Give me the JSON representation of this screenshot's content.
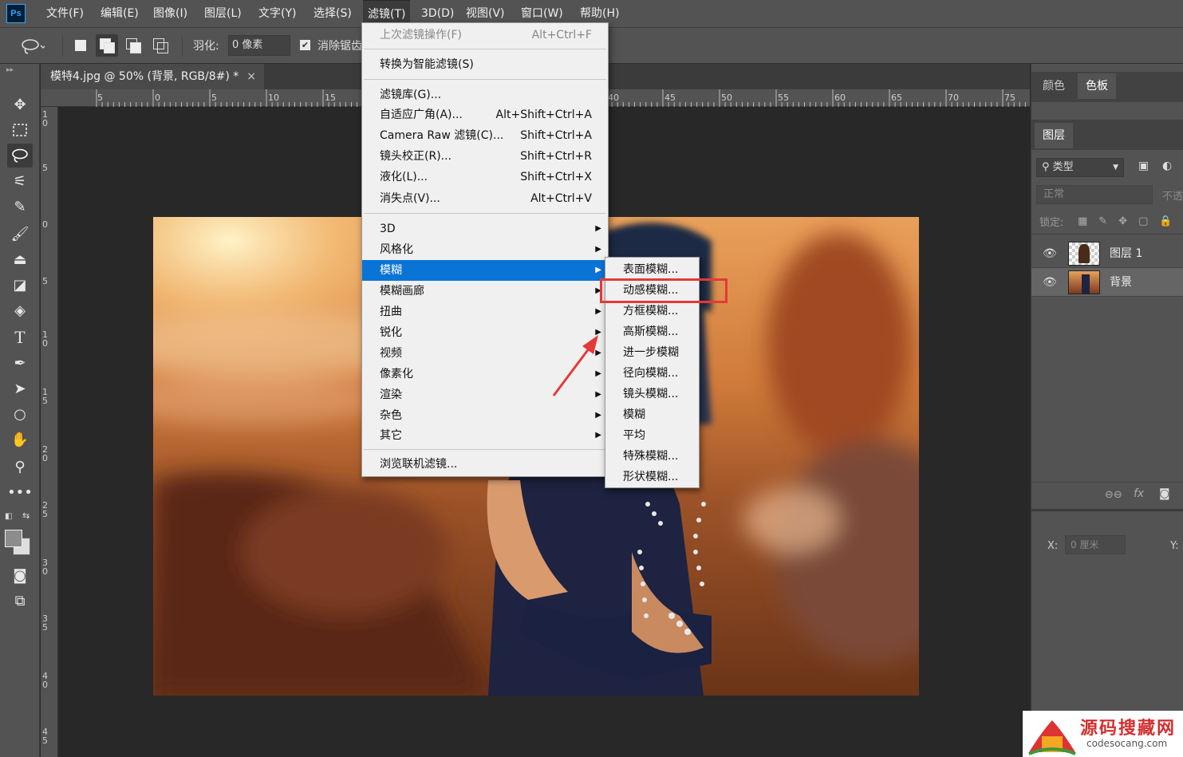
{
  "app": {
    "logo": "Ps"
  },
  "menubar": {
    "items": [
      "文件(F)",
      "编辑(E)",
      "图像(I)",
      "图层(L)",
      "文字(Y)",
      "选择(S)",
      "滤镜(T)",
      "3D(D)",
      "视图(V)",
      "窗口(W)",
      "帮助(H)"
    ]
  },
  "options": {
    "feather_label": "羽化:",
    "feather_value": "0 像素",
    "antialias_label": "消除锯齿"
  },
  "document": {
    "tab_title": "模特4.jpg @ 50% (背景, RGB/8#) *",
    "close_glyph": "×"
  },
  "rulers": {
    "h_ticks": [
      "5",
      "0",
      "5",
      "10",
      "15",
      "40",
      "45",
      "50",
      "55",
      "60",
      "65",
      "70",
      "75"
    ],
    "v_ticks": [
      "1 0",
      "5",
      "0",
      "5",
      "1 0",
      "1 5",
      "2 0",
      "2 5",
      "3 0",
      "3 5",
      "4 0",
      "4 5"
    ]
  },
  "filter_menu": {
    "last_filter": {
      "label": "上次滤镜操作(F)",
      "shortcut": "Alt+Ctrl+F"
    },
    "smart": "转换为智能滤镜(S)",
    "group1": [
      {
        "label": "滤镜库(G)...",
        "shortcut": ""
      },
      {
        "label": "自适应广角(A)...",
        "shortcut": "Alt+Shift+Ctrl+A"
      },
      {
        "label": "Camera Raw 滤镜(C)...",
        "shortcut": "Shift+Ctrl+A"
      },
      {
        "label": "镜头校正(R)...",
        "shortcut": "Shift+Ctrl+R"
      },
      {
        "label": "液化(L)...",
        "shortcut": "Shift+Ctrl+X"
      },
      {
        "label": "消失点(V)...",
        "shortcut": "Alt+Ctrl+V"
      }
    ],
    "submenus": [
      "3D",
      "风格化",
      "模糊",
      "模糊画廊",
      "扭曲",
      "锐化",
      "视频",
      "像素化",
      "渲染",
      "杂色",
      "其它"
    ],
    "browse": "浏览联机滤镜..."
  },
  "blur_submenu": [
    "表面模糊...",
    "动感模糊...",
    "方框模糊...",
    "高斯模糊...",
    "进一步模糊",
    "径向模糊...",
    "镜头模糊...",
    "模糊",
    "平均",
    "特殊模糊...",
    "形状模糊..."
  ],
  "right_panel": {
    "tabs1": [
      "颜色",
      "色板"
    ],
    "tabs2": [
      "图层"
    ],
    "kind_label": "类型",
    "blend_mode": "正常",
    "opacity_label": "不透",
    "lock_label": "锁定:",
    "layers": [
      {
        "name": "图层 1"
      },
      {
        "name": "背景"
      }
    ],
    "props_x_label": "X:",
    "props_x_value": "0 厘米",
    "props_y_label": "Y:"
  },
  "watermark": {
    "title": "源码搜藏网",
    "url": "codesocang.com"
  },
  "colors": {
    "highlight": "#0a74d6",
    "callout": "#e53935"
  }
}
